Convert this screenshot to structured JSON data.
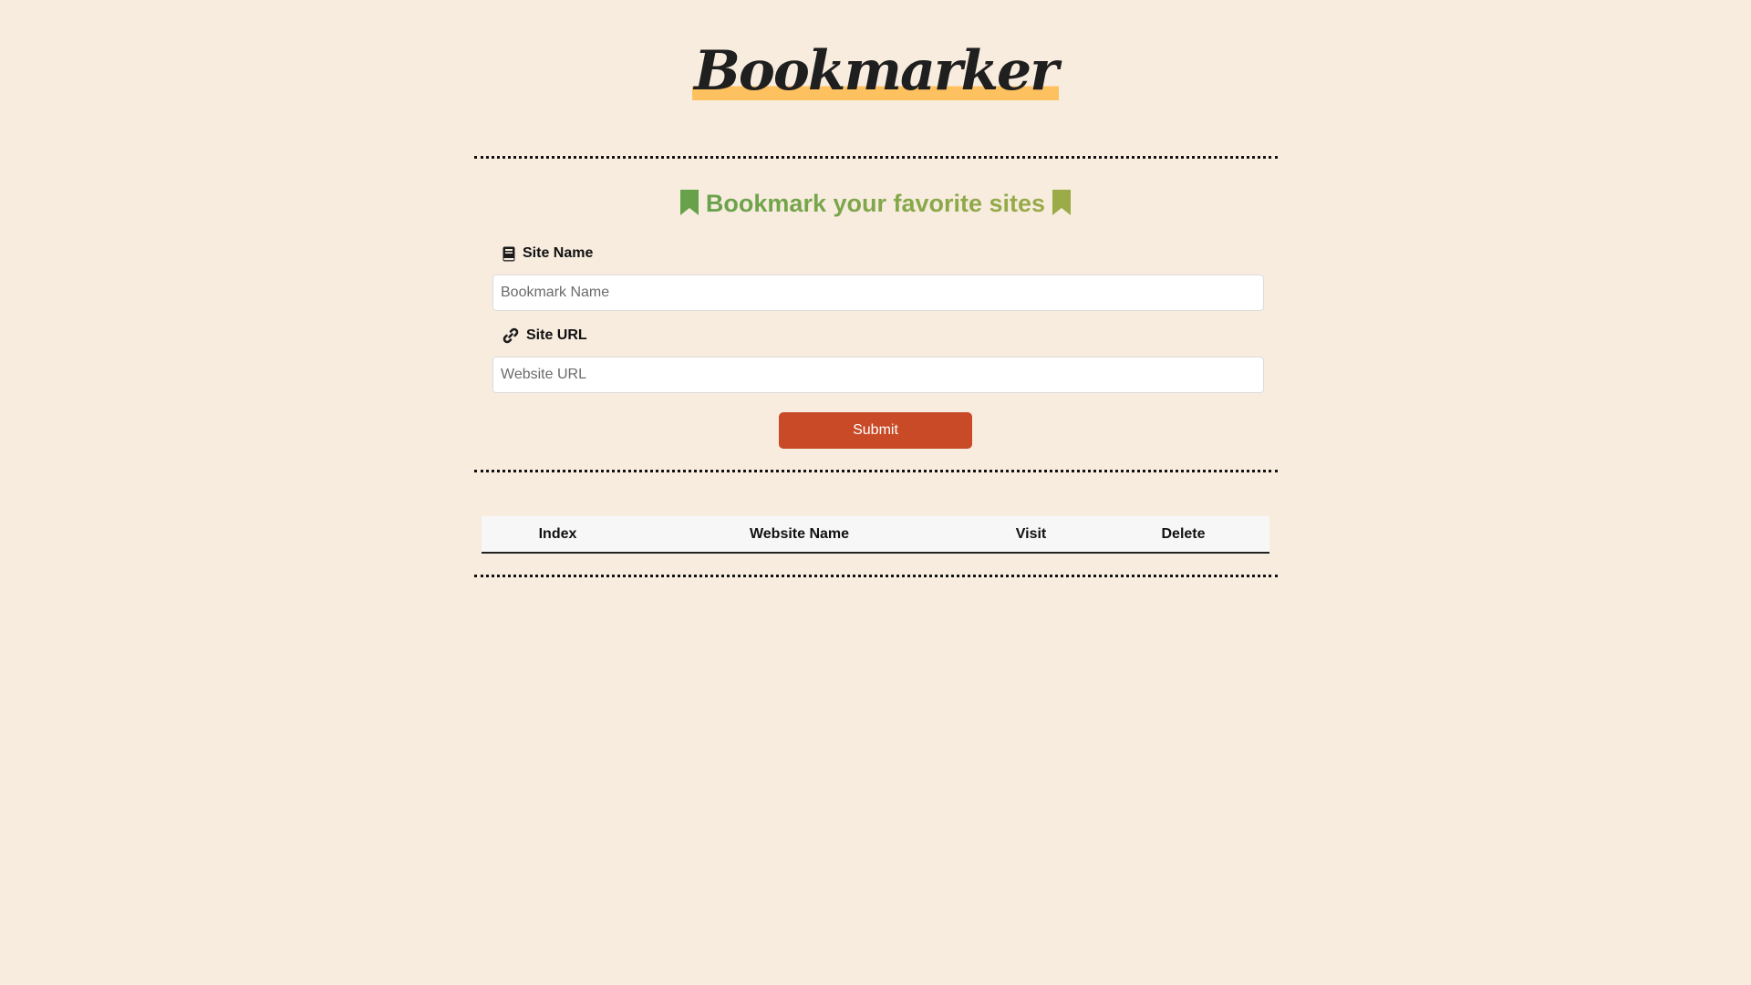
{
  "app": {
    "logo_text": "Bookmarker"
  },
  "form": {
    "title": "Bookmark your favorite sites",
    "site_name_label": "Site Name",
    "site_name_placeholder": "Bookmark Name",
    "site_name_value": "",
    "site_url_label": "Site URL",
    "site_url_placeholder": "Website URL",
    "site_url_value": "",
    "submit_label": "Submit",
    "icons": {
      "title_left": "bookmark-icon",
      "title_right": "bookmark-icon",
      "site_name": "book-icon",
      "site_url": "link-icon"
    }
  },
  "table": {
    "columns": [
      "Index",
      "Website Name",
      "Visit",
      "Delete"
    ],
    "rows": []
  },
  "colors": {
    "background": "#f8ecdf",
    "accent_green": "#6fa14a",
    "logo_highlight": "#fec160",
    "submit_button": "#c84a27"
  }
}
